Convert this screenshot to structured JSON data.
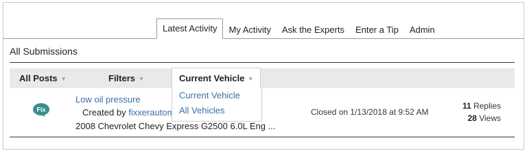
{
  "tabs": [
    {
      "label": "Latest Activity",
      "active": true
    },
    {
      "label": "My Activity"
    },
    {
      "label": "Ask the Experts"
    },
    {
      "label": "Enter a Tip"
    },
    {
      "label": "Admin"
    }
  ],
  "section_title": "All Submissions",
  "filters": {
    "all_posts": "All Posts",
    "filters": "Filters",
    "current_vehicle": "Current Vehicle",
    "dropdown_options": [
      "Current Vehicle",
      "All Vehicles"
    ]
  },
  "post": {
    "icon_text": "Fix",
    "title": "Low oil pressure",
    "created_prefix": "Created by",
    "author": "fixxerautom",
    "vehicle": "2008 Chevrolet Chevy Express G2500 6.0L Eng ...",
    "status": "Closed on 1/13/2018 at 9:52 AM",
    "replies_count": "11",
    "replies_label": "Replies",
    "views_count": "28",
    "views_label": "Views"
  },
  "colors": {
    "link": "#3a6fa6",
    "icon_bg": "#3a8c8e",
    "filter_bar": "#e9e9e9"
  }
}
